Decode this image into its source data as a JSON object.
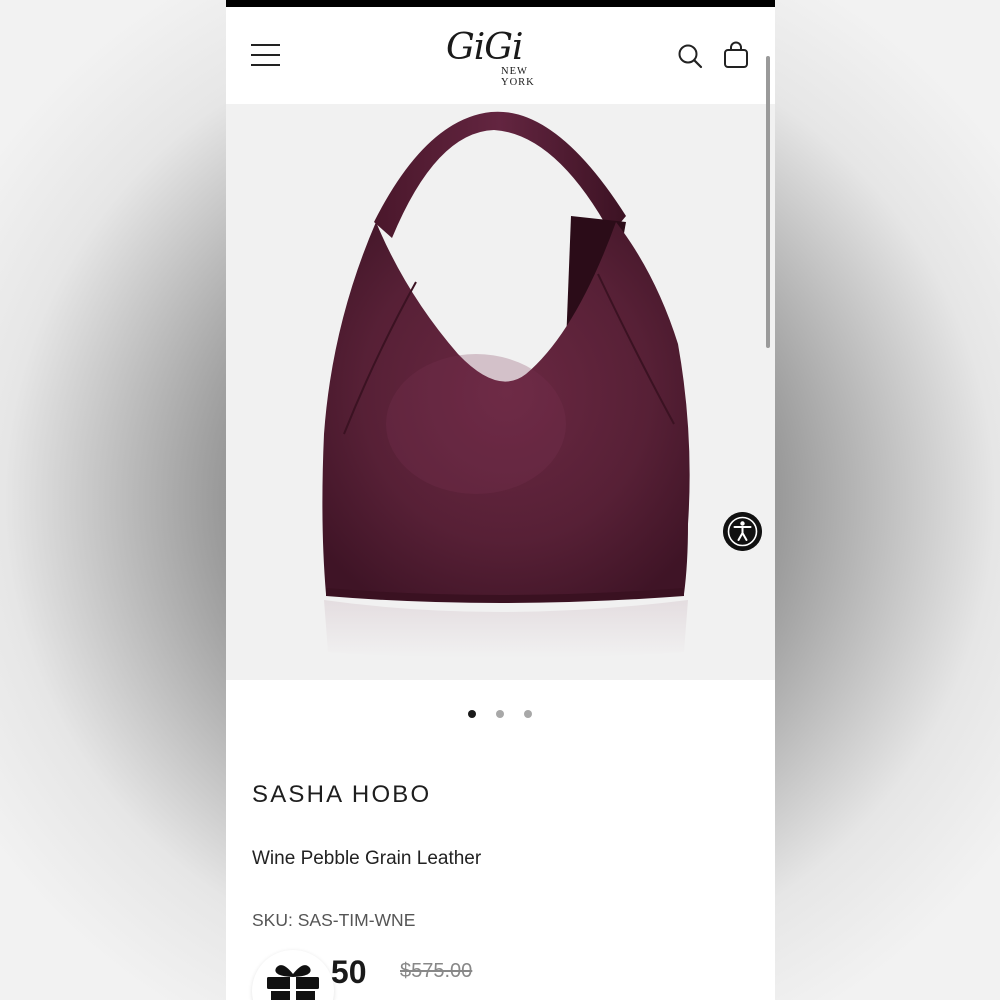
{
  "header": {
    "logo_script": "GiGi",
    "logo_sub": "NEW YORK",
    "menu_icon": "hamburger-menu-icon",
    "search_icon": "search-icon",
    "bag_icon": "shopping-bag-icon"
  },
  "gallery": {
    "image_alt": "Sasha Hobo bag in wine pebble grain leather",
    "dots": [
      {
        "active": true
      },
      {
        "active": false
      },
      {
        "active": false
      }
    ],
    "accessibility_icon": "accessibility-icon"
  },
  "product": {
    "title": "SASHA HOBO",
    "subtitle": "Wine Pebble Grain Leather",
    "sku_label": "SKU:",
    "sku_value": "SAS-TIM-WNE",
    "sale_price_visible": ".50",
    "original_price": "$575.00"
  },
  "gift": {
    "icon": "gift-icon"
  },
  "colors": {
    "leather": "#5a1f35",
    "leather_dark": "#3e1324",
    "leather_light": "#6e2a45",
    "image_bg": "#f1f1f1",
    "dot_active": "#1a1a1a",
    "dot_inactive": "#a8a8a8"
  }
}
